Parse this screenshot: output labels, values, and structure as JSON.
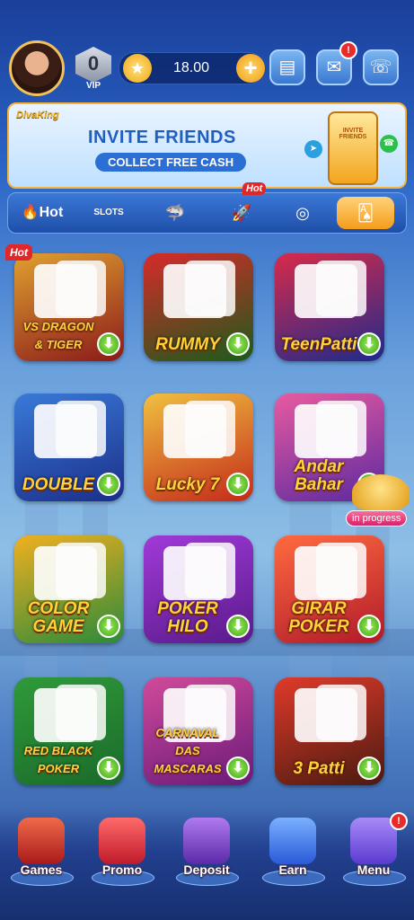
{
  "header": {
    "vip_level": "0",
    "vip_label": "VIP",
    "balance": "18.00",
    "mail_badge": "!"
  },
  "banner": {
    "logo": "DivaKing",
    "title": "INVITE FRIENDS",
    "subtitle": "COLLECT FREE CASH",
    "phone_text": "INVITE FRIENDS"
  },
  "tabs": [
    {
      "label": "Hot",
      "icon": "flame-icon"
    },
    {
      "label": "SLOTS",
      "icon": "slots-icon"
    },
    {
      "label": "",
      "icon": "shark-icon"
    },
    {
      "label": "",
      "icon": "rocket-icon",
      "tag": "Hot"
    },
    {
      "label": "",
      "icon": "roulette-icon"
    },
    {
      "label": "",
      "icon": "cards-icon",
      "active": true
    }
  ],
  "games": [
    {
      "name": "VS DRAGON & TIGER",
      "hot": "Hot",
      "colors": [
        "#8a1a1a",
        "#e0a030"
      ]
    },
    {
      "name": "RUMMY",
      "colors": [
        "#1a5b1a",
        "#d82a2a"
      ]
    },
    {
      "name": "TeenPatti",
      "colors": [
        "#1e2a8c",
        "#d82a4a"
      ]
    },
    {
      "name": "DOUBLE",
      "colors": [
        "#1a2f8a",
        "#3a7ad8"
      ]
    },
    {
      "name": "Lucky 7",
      "colors": [
        "#c42a1a",
        "#f0c040"
      ]
    },
    {
      "name": "Andar Bahar",
      "colors": [
        "#5b2aa0",
        "#e85aa0"
      ],
      "status": "in progress"
    },
    {
      "name": "COLOR GAME",
      "colors": [
        "#2a8a3a",
        "#f0b020"
      ]
    },
    {
      "name": "POKER HILO",
      "colors": [
        "#5a1a8a",
        "#a03ad8"
      ]
    },
    {
      "name": "GIRAR POKER",
      "colors": [
        "#b01a2a",
        "#ff6a40"
      ]
    },
    {
      "name": "RED BLACK POKER",
      "colors": [
        "#1a6a2a",
        "#2f9a3a"
      ]
    },
    {
      "name": "CARNAVAL DAS MASCARAS",
      "colors": [
        "#6a1a7a",
        "#d04a9a"
      ]
    },
    {
      "name": "3 Patti",
      "colors": [
        "#4a1a10",
        "#e03a2a"
      ]
    }
  ],
  "nav": [
    {
      "label": "Games",
      "icon": "slot-machine-icon",
      "color": "#d33a2a"
    },
    {
      "label": "Promo",
      "icon": "gift-icon",
      "color": "#e03a3a"
    },
    {
      "label": "Deposit",
      "icon": "wallet-icon",
      "color": "#8a4ad0"
    },
    {
      "label": "Earn",
      "icon": "phone-money-icon",
      "color": "#3a6ad8"
    },
    {
      "label": "Menu",
      "icon": "menu-grid-icon",
      "color": "#7a5ae0",
      "badge": "!"
    }
  ]
}
